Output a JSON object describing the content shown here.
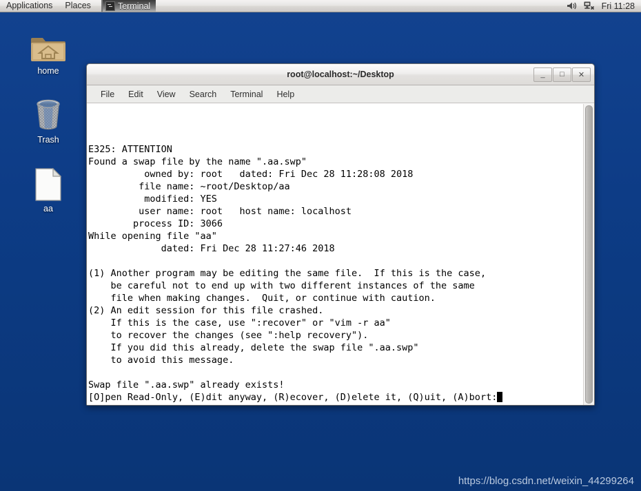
{
  "top_panel": {
    "menus": [
      {
        "label": "Applications",
        "name": "applications-menu"
      },
      {
        "label": "Places",
        "name": "places-menu"
      }
    ],
    "window_list": [
      {
        "label": "Terminal",
        "icon": "terminal-icon",
        "active": true
      }
    ],
    "tray": {
      "volume_icon": "volume-icon",
      "network_icon": "network-disconnected-icon"
    },
    "clock": "Fri 11:28"
  },
  "desktop": {
    "background_color": "#0d3c86",
    "icons": [
      {
        "label": "home",
        "icon": "home-folder-icon"
      },
      {
        "label": "Trash",
        "icon": "trash-can-icon"
      },
      {
        "label": "aa",
        "icon": "text-document-icon"
      }
    ]
  },
  "terminal": {
    "title": "root@localhost:~/Desktop",
    "controls": {
      "minimize": "_",
      "maximize": "□",
      "close": "✕"
    },
    "menus": [
      "File",
      "Edit",
      "View",
      "Search",
      "Terminal",
      "Help"
    ],
    "screen_lines": [
      "",
      "",
      "E325: ATTENTION",
      "Found a swap file by the name \".aa.swp\"",
      "          owned by: root   dated: Fri Dec 28 11:28:08 2018",
      "         file name: ~root/Desktop/aa",
      "          modified: YES",
      "         user name: root   host name: localhost",
      "        process ID: 3066",
      "While opening file \"aa\"",
      "             dated: Fri Dec 28 11:27:46 2018",
      "",
      "(1) Another program may be editing the same file.  If this is the case,",
      "    be careful not to end up with two different instances of the same",
      "    file when making changes.  Quit, or continue with caution.",
      "(2) An edit session for this file crashed.",
      "    If this is the case, use \":recover\" or \"vim -r aa\"",
      "    to recover the changes (see \":help recovery\").",
      "    If you did this already, delete the swap file \".aa.swp\"",
      "    to avoid this message.",
      "",
      "Swap file \".aa.swp\" already exists!"
    ],
    "prompt_line": "[O]pen Read-Only, (E)dit anyway, (R)ecover, (D)elete it, (Q)uit, (A)bort:",
    "cursor": "block"
  },
  "watermark": {
    "text": "https://blog.csdn.net/weixin_44299264"
  }
}
